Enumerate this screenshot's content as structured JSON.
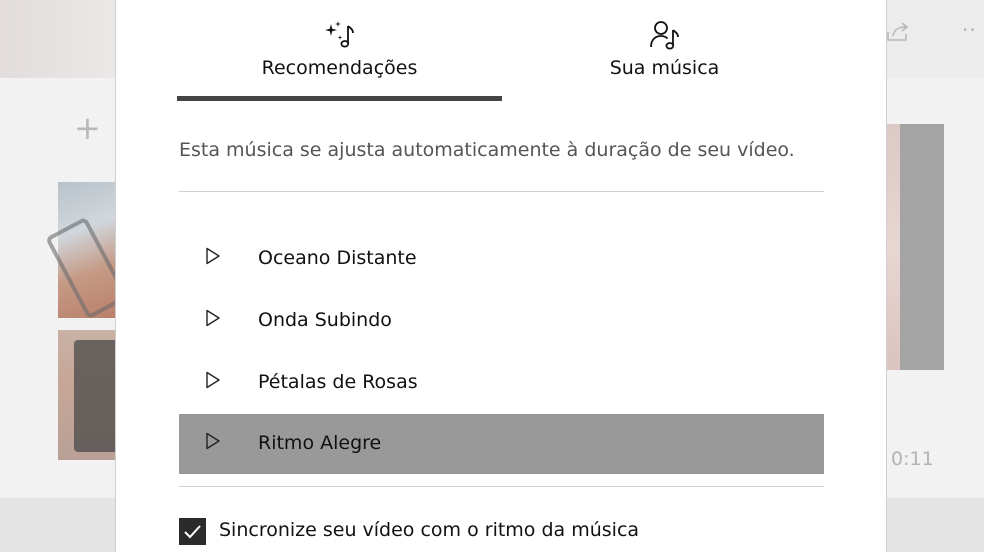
{
  "tabs": [
    {
      "label": "Recomendações",
      "icon": "sparkle-music-note-icon",
      "selected": true
    },
    {
      "label": "Sua música",
      "icon": "person-music-note-icon",
      "selected": false
    }
  ],
  "description": "Esta música se ajusta automaticamente à duração de seu vídeo.",
  "tracks": [
    {
      "title": "Oceano Distante",
      "selected": false
    },
    {
      "title": "Onda Subindo",
      "selected": false
    },
    {
      "title": "Pétalas de Rosas",
      "selected": false
    },
    {
      "title": "Ritmo Alegre",
      "selected": true
    }
  ],
  "sync_option": {
    "label": "Sincronize seu vídeo com o ritmo da música",
    "checked": true
  },
  "background": {
    "timestamp": "0:11"
  },
  "colors": {
    "selected_row": "#999999",
    "tab_underline": "#444444",
    "checkbox": "#2b2b2b"
  }
}
